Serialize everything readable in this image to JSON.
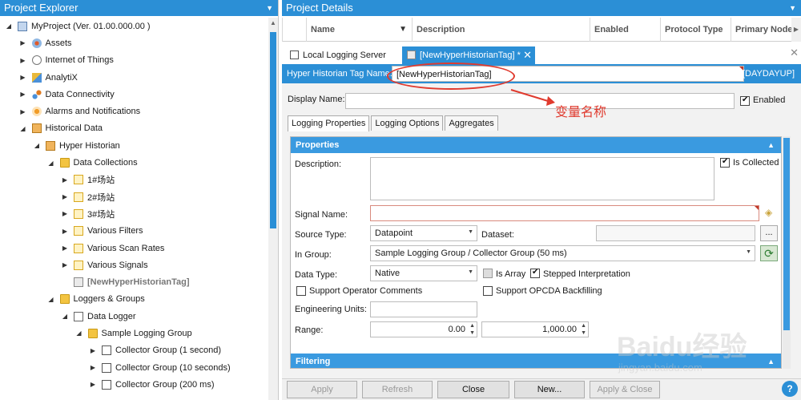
{
  "explorer": {
    "title": "Project Explorer",
    "items": [
      {
        "label": "MyProject (Ver. 01.00.000.00 )",
        "level": 0,
        "expanded": true,
        "icon": "project-icon"
      },
      {
        "label": "Assets",
        "level": 1,
        "expanded": false,
        "icon": "assets-icon"
      },
      {
        "label": "Internet of Things",
        "level": 1,
        "expanded": false,
        "icon": "iot-icon"
      },
      {
        "label": "AnalytiX",
        "level": 1,
        "expanded": false,
        "icon": "analytix-icon"
      },
      {
        "label": "Data Connectivity",
        "level": 1,
        "expanded": false,
        "icon": "data-connectivity-icon"
      },
      {
        "label": "Alarms and Notifications",
        "level": 1,
        "expanded": false,
        "icon": "alarm-icon"
      },
      {
        "label": "Historical Data",
        "level": 1,
        "expanded": true,
        "icon": "historical-data-icon"
      },
      {
        "label": "Hyper Historian",
        "level": 2,
        "expanded": true,
        "icon": "hyper-historian-icon"
      },
      {
        "label": "Data Collections",
        "level": 3,
        "expanded": true,
        "icon": "folder-icon"
      },
      {
        "label": "1#场站",
        "level": 4,
        "expanded": false,
        "icon": "document-icon"
      },
      {
        "label": "2#场站",
        "level": 4,
        "expanded": false,
        "icon": "document-icon"
      },
      {
        "label": "3#场站",
        "level": 4,
        "expanded": false,
        "icon": "document-icon"
      },
      {
        "label": "Various Filters",
        "level": 4,
        "expanded": false,
        "icon": "document-icon"
      },
      {
        "label": "Various Scan Rates",
        "level": 4,
        "expanded": false,
        "icon": "document-icon"
      },
      {
        "label": "Various Signals",
        "level": 4,
        "expanded": false,
        "icon": "document-icon"
      },
      {
        "label": "[NewHyperHistorianTag]",
        "level": 4,
        "expanded": null,
        "icon": "tag-icon",
        "grey": true
      },
      {
        "label": "Loggers & Groups",
        "level": 3,
        "expanded": true,
        "icon": "folder-icon"
      },
      {
        "label": "Data Logger",
        "level": 4,
        "expanded": true,
        "icon": "data-logger-icon"
      },
      {
        "label": "Sample Logging Group",
        "level": 5,
        "expanded": true,
        "icon": "folder-icon"
      },
      {
        "label": "Collector Group (1 second)",
        "level": 6,
        "expanded": false,
        "icon": "collector-icon"
      },
      {
        "label": "Collector Group (10 seconds)",
        "level": 6,
        "expanded": false,
        "icon": "collector-icon"
      },
      {
        "label": "Collector Group (200 ms)",
        "level": 6,
        "expanded": false,
        "icon": "collector-icon"
      }
    ]
  },
  "details": {
    "title": "Project Details",
    "columns": [
      "Name",
      "Description",
      "Enabled",
      "Protocol Type",
      "Primary Node"
    ]
  },
  "tabs": [
    {
      "label": "Local Logging Server",
      "active": false
    },
    {
      "label": "[NewHyperHistorianTag] *",
      "active": true
    }
  ],
  "form": {
    "name_label": "Hyper Historian Tag Name:",
    "name_value": "[NewHyperHistorianTag]",
    "server_tag": "[DAYDAYUP]",
    "display_name_label": "Display Name:",
    "display_name_value": "",
    "enabled_label": "Enabled",
    "enabled_checked": true,
    "subtabs": [
      "Logging Properties",
      "Logging Options",
      "Aggregates"
    ],
    "properties": {
      "header": "Properties",
      "description_label": "Description:",
      "is_collected_label": "Is Collected",
      "is_collected_checked": true,
      "signal_name_label": "Signal Name:",
      "source_type_label": "Source Type:",
      "source_type_value": "Datapoint",
      "dataset_label": "Dataset:",
      "dataset_button": "...",
      "in_group_label": "In Group:",
      "in_group_value": "Sample Logging Group / Collector Group (50 ms)",
      "data_type_label": "Data Type:",
      "data_type_value": "Native",
      "is_array_label": "Is Array",
      "is_array_checked": false,
      "stepped_label": "Stepped Interpretation",
      "stepped_checked": true,
      "operator_comments_label": "Support Operator Comments",
      "opcda_backfilling_label": "Support OPCDA Backfilling",
      "engineering_units_label": "Engineering Units:",
      "range_label": "Range:",
      "range_min": "0.00",
      "range_max": "1,000.00"
    },
    "filtering_header": "Filtering"
  },
  "bottom_buttons": [
    {
      "label": "Apply",
      "enabled": false
    },
    {
      "label": "Refresh",
      "enabled": false
    },
    {
      "label": "Close",
      "enabled": true
    },
    {
      "label": "New...",
      "enabled": true
    },
    {
      "label": "Apply & Close",
      "enabled": false
    }
  ],
  "help_label": "?",
  "annotation": {
    "note": "变量名称",
    "color": "#e03a2e"
  },
  "watermark": {
    "logo": "Baidu经验",
    "url": "jingyan.baidu.com"
  },
  "accent_color": "#2b8fd6"
}
